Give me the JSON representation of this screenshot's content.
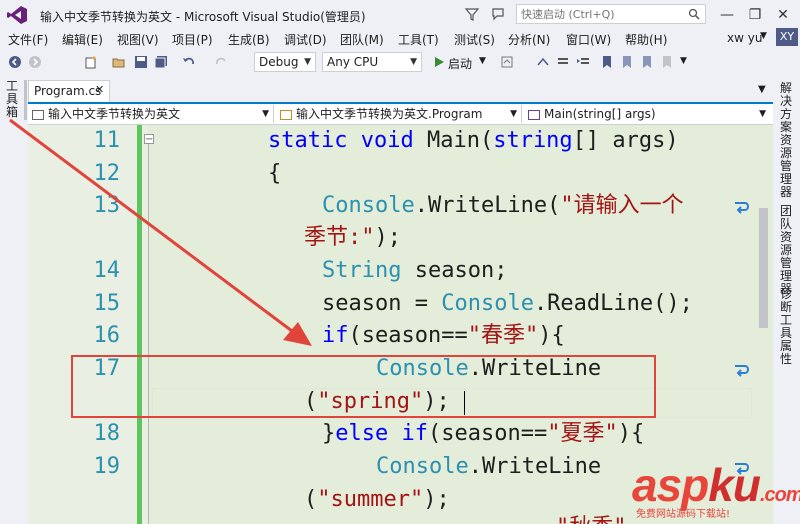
{
  "window": {
    "title": "输入中文季节转换为英文 - Microsoft Visual Studio(管理员)",
    "quick_launch_placeholder": "快速启动 (Ctrl+Q)",
    "minimize": "—",
    "restore": "❐",
    "close": "✕"
  },
  "menu": [
    "文件(F)",
    "编辑(E)",
    "视图(V)",
    "项目(P)",
    "生成(B)",
    "调试(D)",
    "团队(M)",
    "工具(T)",
    "测试(S)",
    "分析(N)",
    "窗口(W)",
    "帮助(H)"
  ],
  "account": {
    "name": "xw yu",
    "initials": "XY"
  },
  "toolbar": {
    "config": "Debug",
    "platform": "Any CPU",
    "start": "启动"
  },
  "left_panel": {
    "toolbox": "工具箱"
  },
  "right_panel": {
    "tabs": [
      "解决方案资源管理器",
      "团队资源管理器",
      "诊断工具",
      "属性"
    ]
  },
  "tab": {
    "label": "Program.cs",
    "close": "✕"
  },
  "navbar": {
    "project": "输入中文季节转换为英文",
    "class": "输入中文季节转换为英文.Program",
    "member": "Main(string[] args)"
  },
  "code": {
    "l11": {
      "num": "11",
      "kw1": "static",
      "kw2": "void",
      "name": "Main(",
      "type": "string",
      "rest": "[] args)"
    },
    "l12": {
      "num": "12",
      "text": "{"
    },
    "l13": {
      "num": "13",
      "type": "Console",
      "call": ".WriteLine(",
      "str_a": "\"请输入一个",
      "str_b": "季节:\"",
      "end": ");"
    },
    "l14": {
      "num": "14",
      "type": "String",
      "rest": " season;"
    },
    "l15": {
      "num": "15",
      "lhs": "season = ",
      "type": "Console",
      "rest": ".ReadLine();"
    },
    "l16": {
      "num": "16",
      "kw": "if",
      "pre": "(season==",
      "str": "\"春季\"",
      "post": "){"
    },
    "l17": {
      "num": "17",
      "type": "Console",
      "call": ".WriteLine",
      "open": "(",
      "str": "\"spring\"",
      "end": ");"
    },
    "l18": {
      "num": "18",
      "pre": "}",
      "kw1": "else",
      "kw2": "if",
      "mid": "(season==",
      "str": "\"夏季\"",
      "post": "){"
    },
    "l19": {
      "num": "19",
      "type": "Console",
      "call": ".WriteLine",
      "open": "(",
      "str": "\"summer\"",
      "end": ");"
    },
    "l20": {
      "str": "\"秋季\""
    }
  },
  "watermark": {
    "main_a": "asp",
    "main_b": "ku",
    "main_c": ".com",
    "sub": "免费网站源码下载站!"
  },
  "colors": {
    "keyword": "#0000ff",
    "type": "#2b91af",
    "string": "#a31515",
    "annotation": "#e0443a"
  }
}
